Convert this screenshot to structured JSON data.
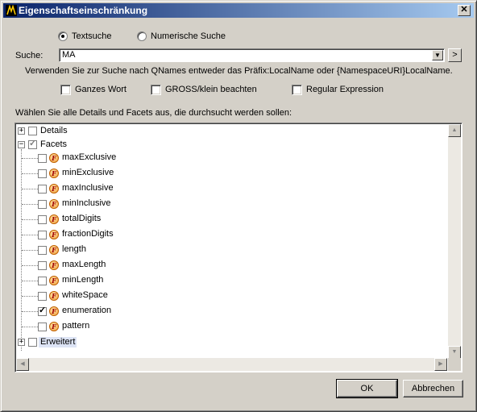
{
  "window": {
    "title": "Eigenschaftseinschränkung",
    "close_label": "✕"
  },
  "search_mode": {
    "text_label": "Textsuche",
    "numeric_label": "Numerische Suche",
    "selected": "text"
  },
  "search": {
    "label": "Suche:",
    "value": "MA",
    "hint": "Verwenden Sie zur Suche nach QNames entweder das Präfix:LocalName oder {NamespaceURI}LocalName.",
    "next_label": ">"
  },
  "options": {
    "whole_word": {
      "label": "Ganzes Wort",
      "checked": false
    },
    "case": {
      "label": "GROSS/klein beachten",
      "checked": false
    },
    "regex": {
      "label": "Regular Expression",
      "checked": false
    }
  },
  "tree": {
    "heading": "Wählen Sie alle Details und Facets aus, die durchsucht werden sollen:",
    "details_label": "Details",
    "facets_label": "Facets",
    "facet_icon_letter": "F",
    "facets": [
      {
        "label": "maxExclusive",
        "checked": false
      },
      {
        "label": "minExclusive",
        "checked": false
      },
      {
        "label": "maxInclusive",
        "checked": false
      },
      {
        "label": "minInclusive",
        "checked": false
      },
      {
        "label": "totalDigits",
        "checked": false
      },
      {
        "label": "fractionDigits",
        "checked": false
      },
      {
        "label": "length",
        "checked": false
      },
      {
        "label": "maxLength",
        "checked": false
      },
      {
        "label": "minLength",
        "checked": false
      },
      {
        "label": "whiteSpace",
        "checked": false
      },
      {
        "label": "enumeration",
        "checked": true
      },
      {
        "label": "pattern",
        "checked": false
      }
    ],
    "extended_label": "Erweitert"
  },
  "buttons": {
    "ok": "OK",
    "cancel": "Abbrechen"
  },
  "colors": {
    "title_start": "#0a246a",
    "title_end": "#a6caf0",
    "dialog_bg": "#d4d0c8"
  }
}
